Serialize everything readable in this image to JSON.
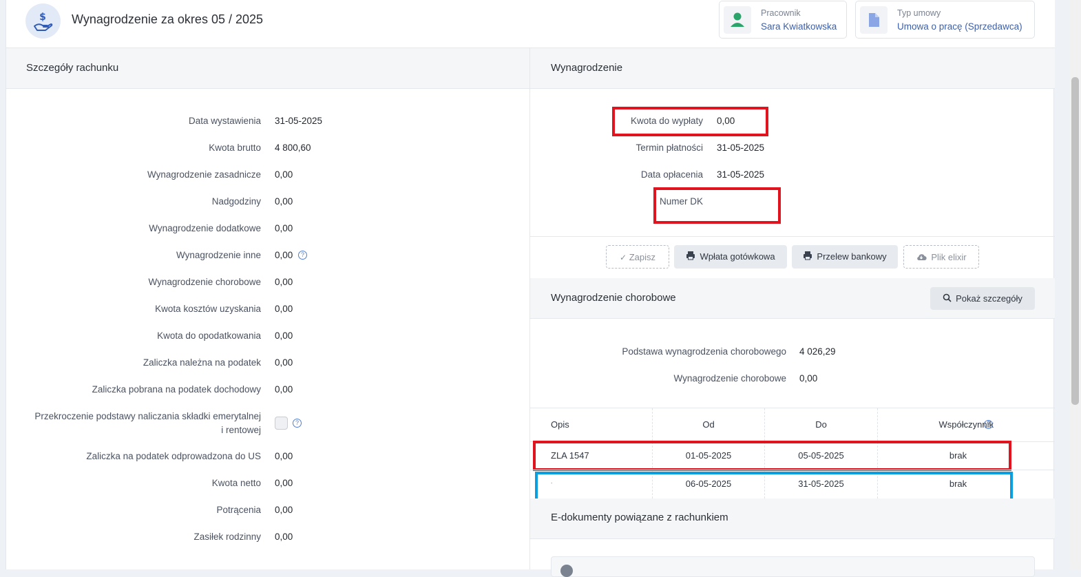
{
  "header": {
    "title": "Wynagrodzenie za okres 05 / 2025",
    "employee_label": "Pracownik",
    "employee_name": "Sara Kwiatkowska",
    "contract_label": "Typ umowy",
    "contract_value": "Umowa o pracę (Sprzedawca)"
  },
  "left": {
    "title": "Szczegóły rachunku",
    "rows": [
      {
        "label": "Data wystawienia",
        "value": "31-05-2025"
      },
      {
        "label": "Kwota brutto",
        "value": "4 800,60"
      },
      {
        "label": "Wynagrodzenie zasadnicze",
        "value": "0,00"
      },
      {
        "label": "Nadgodziny",
        "value": "0,00"
      },
      {
        "label": "Wynagrodzenie dodatkowe",
        "value": "0,00"
      },
      {
        "label": "Wynagrodzenie inne",
        "value": "0,00"
      },
      {
        "label": "Wynagrodzenie chorobowe",
        "value": "0,00"
      },
      {
        "label": "Kwota kosztów uzyskania",
        "value": "0,00"
      },
      {
        "label": "Kwota do opodatkowania",
        "value": "0,00"
      },
      {
        "label": "Zaliczka należna na podatek",
        "value": "0,00"
      },
      {
        "label": "Zaliczka pobrana na podatek dochodowy",
        "value": "0,00"
      },
      {
        "label": "Zaliczka na podatek odprowadzona do US",
        "value": "0,00"
      },
      {
        "label": "Kwota netto",
        "value": "0,00"
      },
      {
        "label": "Potrącenia",
        "value": "0,00"
      },
      {
        "label": "Zasiłek rodzinny",
        "value": "0,00"
      }
    ],
    "exceed_label_line1": "Przekroczenie podstawy naliczania składki emerytalnej",
    "exceed_label_line2": "i rentowej",
    "help_glyph": "?"
  },
  "right": {
    "title": "Wynagrodzenie",
    "payout_label": "Kwota do wypłaty",
    "payout_value": "0,00",
    "due_label": "Termin płatności",
    "due_value": "31-05-2025",
    "paid_label": "Data opłacenia",
    "paid_value": "31-05-2025",
    "dk_label": "Numer DK",
    "buttons": {
      "save": "Zapisz",
      "cash": "Wpłata gotówkowa",
      "transfer": "Przelew bankowy",
      "elixir": "Plik elixir"
    }
  },
  "sick": {
    "title": "Wynagrodzenie chorobowe",
    "details_button": "Pokaż szczegóły",
    "base_label": "Podstawa wynagrodzenia chorobowego",
    "base_value": "4 026,29",
    "pay_label": "Wynagrodzenie chorobowe",
    "pay_value": "0,00",
    "columns": [
      "Opis",
      "Od",
      "Do",
      "Współczynnik"
    ],
    "rows": [
      {
        "opis": "ZLA 1547",
        "od": "01-05-2025",
        "do": "05-05-2025",
        "wsp": "brak"
      },
      {
        "opis": ".",
        "od": "06-05-2025",
        "do": "31-05-2025",
        "wsp": "brak"
      }
    ]
  },
  "edocs": {
    "title": "E-dokumenty powiązane z rachunkiem"
  },
  "colors": {
    "highlight_red": "#e0141e",
    "highlight_blue": "#0b9fe0",
    "link_blue": "#3d5fa8"
  }
}
